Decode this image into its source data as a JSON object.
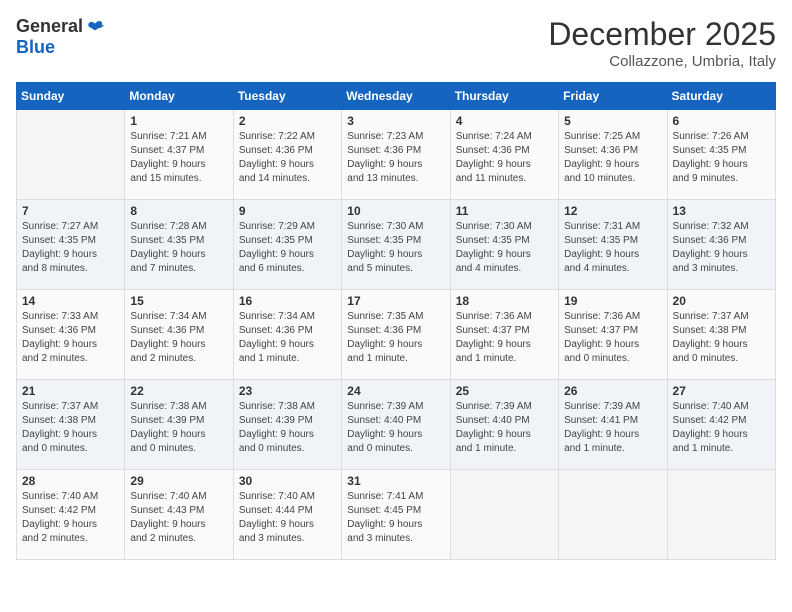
{
  "logo": {
    "general": "General",
    "blue": "Blue"
  },
  "title": {
    "month": "December 2025",
    "location": "Collazzone, Umbria, Italy"
  },
  "weekdays": [
    "Sunday",
    "Monday",
    "Tuesday",
    "Wednesday",
    "Thursday",
    "Friday",
    "Saturday"
  ],
  "weeks": [
    [
      {
        "day": "",
        "info": ""
      },
      {
        "day": "1",
        "info": "Sunrise: 7:21 AM\nSunset: 4:37 PM\nDaylight: 9 hours\nand 15 minutes."
      },
      {
        "day": "2",
        "info": "Sunrise: 7:22 AM\nSunset: 4:36 PM\nDaylight: 9 hours\nand 14 minutes."
      },
      {
        "day": "3",
        "info": "Sunrise: 7:23 AM\nSunset: 4:36 PM\nDaylight: 9 hours\nand 13 minutes."
      },
      {
        "day": "4",
        "info": "Sunrise: 7:24 AM\nSunset: 4:36 PM\nDaylight: 9 hours\nand 11 minutes."
      },
      {
        "day": "5",
        "info": "Sunrise: 7:25 AM\nSunset: 4:36 PM\nDaylight: 9 hours\nand 10 minutes."
      },
      {
        "day": "6",
        "info": "Sunrise: 7:26 AM\nSunset: 4:35 PM\nDaylight: 9 hours\nand 9 minutes."
      }
    ],
    [
      {
        "day": "7",
        "info": "Sunrise: 7:27 AM\nSunset: 4:35 PM\nDaylight: 9 hours\nand 8 minutes."
      },
      {
        "day": "8",
        "info": "Sunrise: 7:28 AM\nSunset: 4:35 PM\nDaylight: 9 hours\nand 7 minutes."
      },
      {
        "day": "9",
        "info": "Sunrise: 7:29 AM\nSunset: 4:35 PM\nDaylight: 9 hours\nand 6 minutes."
      },
      {
        "day": "10",
        "info": "Sunrise: 7:30 AM\nSunset: 4:35 PM\nDaylight: 9 hours\nand 5 minutes."
      },
      {
        "day": "11",
        "info": "Sunrise: 7:30 AM\nSunset: 4:35 PM\nDaylight: 9 hours\nand 4 minutes."
      },
      {
        "day": "12",
        "info": "Sunrise: 7:31 AM\nSunset: 4:35 PM\nDaylight: 9 hours\nand 4 minutes."
      },
      {
        "day": "13",
        "info": "Sunrise: 7:32 AM\nSunset: 4:36 PM\nDaylight: 9 hours\nand 3 minutes."
      }
    ],
    [
      {
        "day": "14",
        "info": "Sunrise: 7:33 AM\nSunset: 4:36 PM\nDaylight: 9 hours\nand 2 minutes."
      },
      {
        "day": "15",
        "info": "Sunrise: 7:34 AM\nSunset: 4:36 PM\nDaylight: 9 hours\nand 2 minutes."
      },
      {
        "day": "16",
        "info": "Sunrise: 7:34 AM\nSunset: 4:36 PM\nDaylight: 9 hours\nand 1 minute."
      },
      {
        "day": "17",
        "info": "Sunrise: 7:35 AM\nSunset: 4:36 PM\nDaylight: 9 hours\nand 1 minute."
      },
      {
        "day": "18",
        "info": "Sunrise: 7:36 AM\nSunset: 4:37 PM\nDaylight: 9 hours\nand 1 minute."
      },
      {
        "day": "19",
        "info": "Sunrise: 7:36 AM\nSunset: 4:37 PM\nDaylight: 9 hours\nand 0 minutes."
      },
      {
        "day": "20",
        "info": "Sunrise: 7:37 AM\nSunset: 4:38 PM\nDaylight: 9 hours\nand 0 minutes."
      }
    ],
    [
      {
        "day": "21",
        "info": "Sunrise: 7:37 AM\nSunset: 4:38 PM\nDaylight: 9 hours\nand 0 minutes."
      },
      {
        "day": "22",
        "info": "Sunrise: 7:38 AM\nSunset: 4:39 PM\nDaylight: 9 hours\nand 0 minutes."
      },
      {
        "day": "23",
        "info": "Sunrise: 7:38 AM\nSunset: 4:39 PM\nDaylight: 9 hours\nand 0 minutes."
      },
      {
        "day": "24",
        "info": "Sunrise: 7:39 AM\nSunset: 4:40 PM\nDaylight: 9 hours\nand 0 minutes."
      },
      {
        "day": "25",
        "info": "Sunrise: 7:39 AM\nSunset: 4:40 PM\nDaylight: 9 hours\nand 1 minute."
      },
      {
        "day": "26",
        "info": "Sunrise: 7:39 AM\nSunset: 4:41 PM\nDaylight: 9 hours\nand 1 minute."
      },
      {
        "day": "27",
        "info": "Sunrise: 7:40 AM\nSunset: 4:42 PM\nDaylight: 9 hours\nand 1 minute."
      }
    ],
    [
      {
        "day": "28",
        "info": "Sunrise: 7:40 AM\nSunset: 4:42 PM\nDaylight: 9 hours\nand 2 minutes."
      },
      {
        "day": "29",
        "info": "Sunrise: 7:40 AM\nSunset: 4:43 PM\nDaylight: 9 hours\nand 2 minutes."
      },
      {
        "day": "30",
        "info": "Sunrise: 7:40 AM\nSunset: 4:44 PM\nDaylight: 9 hours\nand 3 minutes."
      },
      {
        "day": "31",
        "info": "Sunrise: 7:41 AM\nSunset: 4:45 PM\nDaylight: 9 hours\nand 3 minutes."
      },
      {
        "day": "",
        "info": ""
      },
      {
        "day": "",
        "info": ""
      },
      {
        "day": "",
        "info": ""
      }
    ]
  ]
}
